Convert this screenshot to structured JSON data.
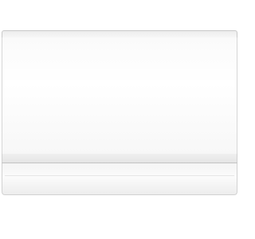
{
  "image": {
    "subject": "air-conditioner-indoor-unit",
    "colors": {
      "background": "#ffffff",
      "body": "#fafafa",
      "edge": "#c9c9c9",
      "louver": "#f0f0f0"
    }
  }
}
